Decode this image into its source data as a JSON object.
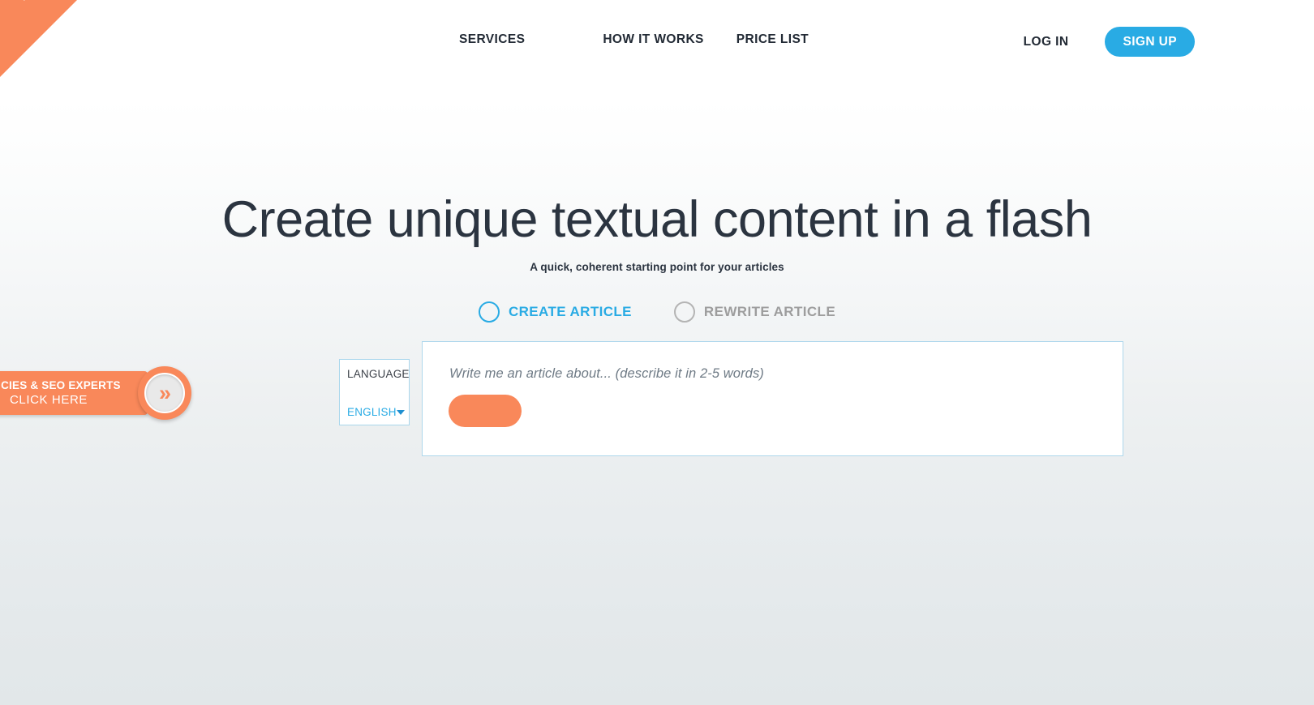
{
  "ribbon": {
    "label": "BETA"
  },
  "nav": {
    "items": [
      {
        "label": "SERVICES",
        "name": "services"
      },
      {
        "label": "HOW IT WORKS",
        "name": "how-it-works"
      },
      {
        "label": "PRICE LIST",
        "name": "price-list"
      }
    ],
    "login_label": "LOG IN",
    "signup_label": "SIGN UP"
  },
  "hero": {
    "title": "Create unique textual content in a flash",
    "subtitle": "A quick, coherent starting point for your articles"
  },
  "modes": [
    {
      "label": "CREATE ARTICLE",
      "selected": true
    },
    {
      "label": "REWRITE ARTICLE",
      "selected": false
    }
  ],
  "language": {
    "label": "LANGUAGE",
    "value": "ENGLISH",
    "icon": "chevron-down-icon",
    "options": [
      "ENGLISH"
    ]
  },
  "input_panel": {
    "placeholder": "Write me an article about... (describe it in 2-5 words)",
    "value": "",
    "submit_label": ""
  },
  "promo": {
    "line1": "GENCIES & SEO EXPERTS",
    "line2": "CLICK HERE",
    "icon": "double-chevron-right-icon",
    "chevrons": "»"
  },
  "colors": {
    "accent_blue": "#29abe4",
    "accent_orange": "#f9885a",
    "text_dark": "#2b3440",
    "muted_gray": "#9d9d9d",
    "panel_border": "#aed7ec",
    "background_top": "#ffffff",
    "background_bottom": "#e2e7e9"
  }
}
